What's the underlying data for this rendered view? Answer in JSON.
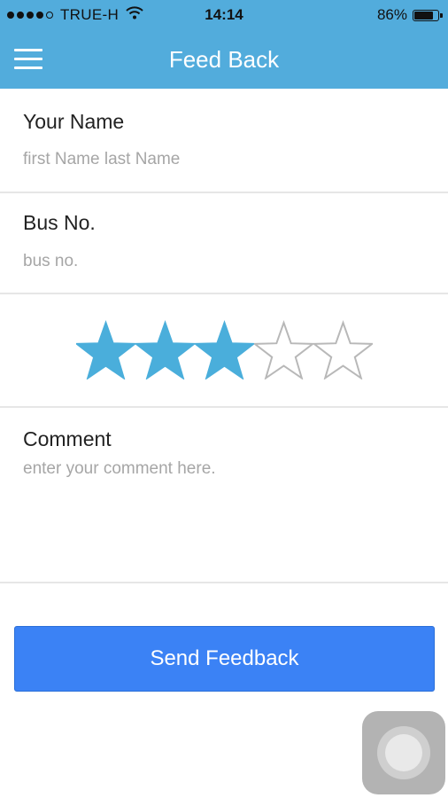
{
  "status_bar": {
    "carrier": "TRUE-H",
    "time": "14:14",
    "battery_percent_text": "86%",
    "battery_level": 0.86,
    "signal_bars_filled": 4,
    "signal_bars_total": 5
  },
  "nav": {
    "title": "Feed Back",
    "menu_icon": "hamburger-menu-icon"
  },
  "form": {
    "name_label": "Your Name",
    "name_placeholder": "first Name last Name",
    "name_value": "",
    "bus_label": "Bus No.",
    "bus_placeholder": "bus no.",
    "bus_value": "",
    "rating": {
      "value": 3,
      "max": 5
    },
    "comment_label": "Comment",
    "comment_placeholder": "enter your comment here.",
    "comment_value": ""
  },
  "send_button_label": "Send Feedback",
  "colors": {
    "header": "#52acdc",
    "star_filled": "#4aaedb",
    "star_empty_stroke": "#b8b8b8",
    "button": "#3b82f5"
  }
}
